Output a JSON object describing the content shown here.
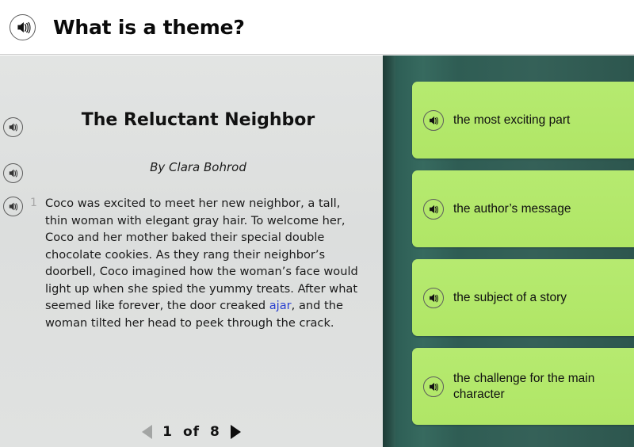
{
  "header": {
    "audio_icon": "speaker-icon",
    "title": "What is a theme?"
  },
  "passage": {
    "audio_icon": "speaker-icon",
    "title": "The Reluctant Neighbor",
    "byline": "By Clara Bohrod",
    "paragraphs": [
      {
        "number": "1",
        "text_before_vocab": "Coco was excited to meet her new neighbor, a tall, thin woman with elegant gray hair. To welcome her, Coco and her mother baked their special double chocolate cookies. As they rang their neighbor’s doorbell, Coco imagined how the woman’s face would light up when she spied the yummy treats. After what seemed like forever, the door creaked ",
        "vocab_word": "ajar",
        "text_after_vocab": ", and the woman tilted her head to peek through the crack."
      }
    ],
    "pagination": {
      "prev_icon": "triangle-left-icon",
      "current_page": "1",
      "separator": "of",
      "total_pages": "8",
      "next_icon": "triangle-right-icon"
    }
  },
  "answers": {
    "options": [
      {
        "label": "the most exciting part",
        "audio_icon": "speaker-icon"
      },
      {
        "label": "the author’s message",
        "audio_icon": "speaker-icon"
      },
      {
        "label": "the subject of a story",
        "audio_icon": "speaker-icon"
      },
      {
        "label": "the challenge for the main character",
        "audio_icon": "speaker-icon"
      }
    ]
  },
  "colors": {
    "answer_panel_bg": "#2f5d54",
    "choice_bg": "#b3e86a",
    "passage_bg": "#dfe1e0",
    "vocab_link": "#2a3fd0",
    "header_bg": "#ffffff"
  }
}
